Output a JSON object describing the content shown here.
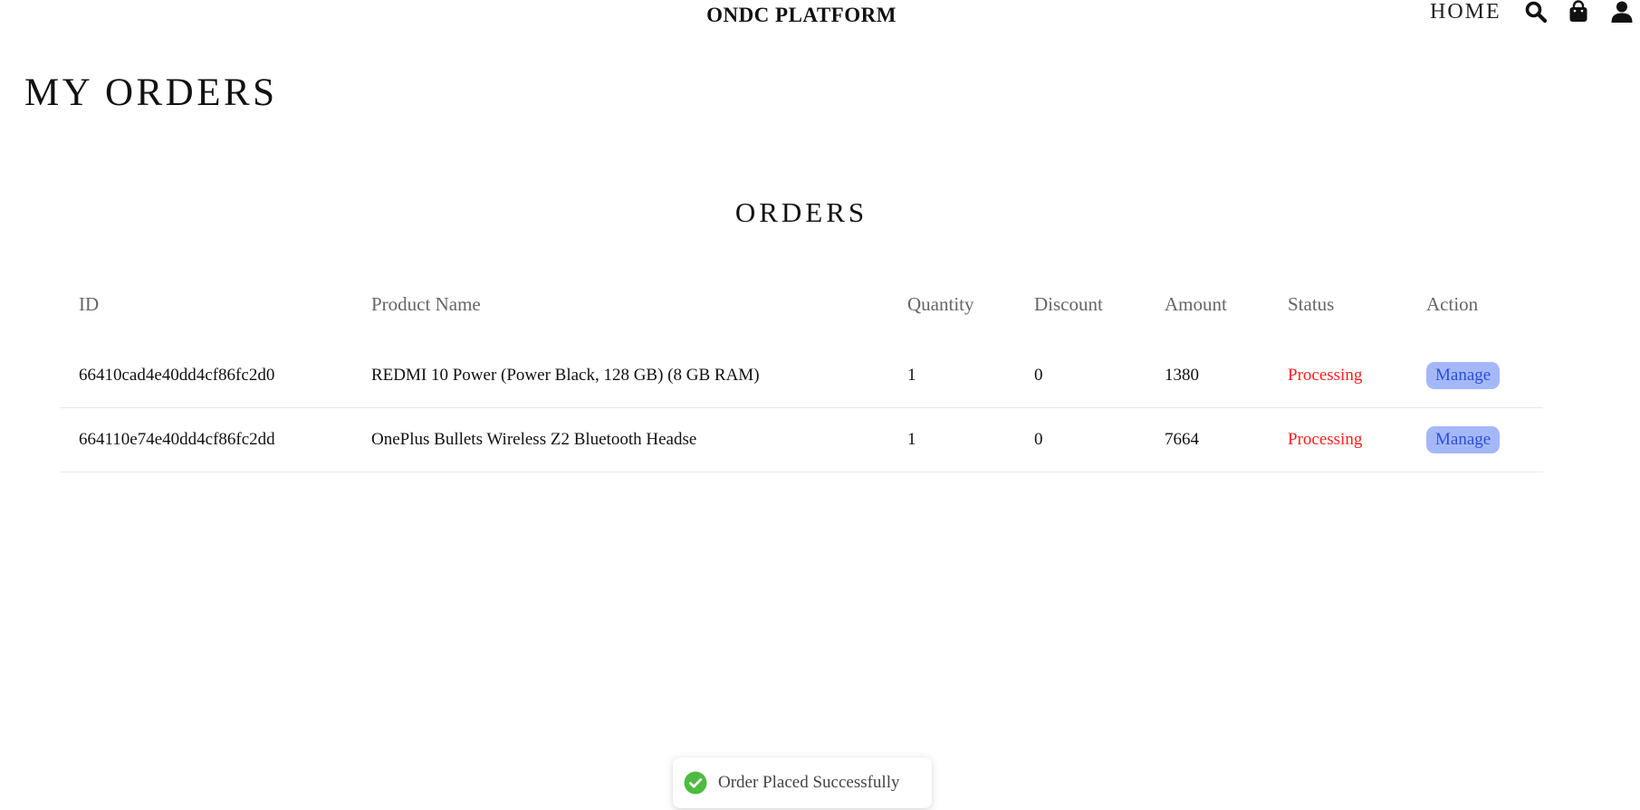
{
  "header": {
    "brand": "ONDC PLATFORM",
    "nav_home": "HOME",
    "icons": [
      "search-icon",
      "shopping-bag-icon",
      "user-icon"
    ]
  },
  "page_title": "MY ORDERS",
  "section_title": "ORDERS",
  "table": {
    "columns": [
      "ID",
      "Product Name",
      "Quantity",
      "Discount",
      "Amount",
      "Status",
      "Action"
    ],
    "rows": [
      {
        "id": "66410cad4e40dd4cf86fc2d0",
        "product_name": "REDMI 10 Power (Power Black, 128 GB) (8 GB RAM)",
        "quantity": "1",
        "discount": "0",
        "amount": "1380",
        "status": "Processing",
        "action": "Manage"
      },
      {
        "id": "664110e74e40dd4cf86fc2dd",
        "product_name": "OnePlus Bullets Wireless Z2 Bluetooth Headse",
        "quantity": "1",
        "discount": "0",
        "amount": "7664",
        "status": "Processing",
        "action": "Manage"
      }
    ]
  },
  "toast": {
    "message": "Order Placed Successfully",
    "icon": "check-circle-icon",
    "accent": "#4cbb3f"
  },
  "colors": {
    "status_processing": "#ff1e1e",
    "manage_button_bg": "#a4b8f9",
    "manage_button_text": "#2c4fd8"
  }
}
